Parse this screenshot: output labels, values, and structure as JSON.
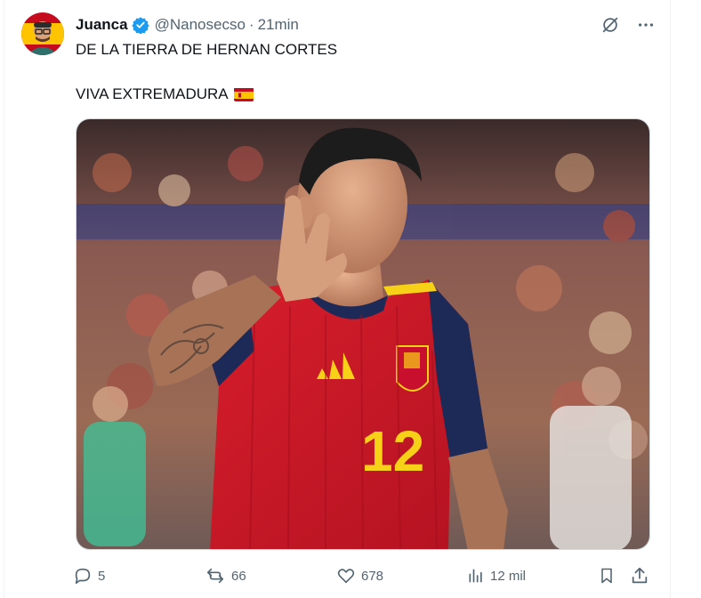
{
  "tweet": {
    "display_name": "Juanca",
    "handle": "@Nanosecso",
    "separator": "·",
    "time": "21min",
    "text_line1": "DE LA TIERRA DE HERNAN CORTES",
    "text_line2": "VIVA EXTREMADURA",
    "flag_icon": "spain-flag-icon",
    "media": {
      "jersey_number": "12",
      "colors": {
        "jersey_red": "#c8102e",
        "jersey_navy": "#1d2a57",
        "number_yellow": "#f7d117"
      }
    }
  },
  "actions": {
    "replies": "5",
    "reposts": "66",
    "likes": "678",
    "views": "12 mil"
  },
  "colors": {
    "verified_blue": "#1d9bf0",
    "secondary_text": "#536471",
    "primary_text": "#0f1419"
  }
}
